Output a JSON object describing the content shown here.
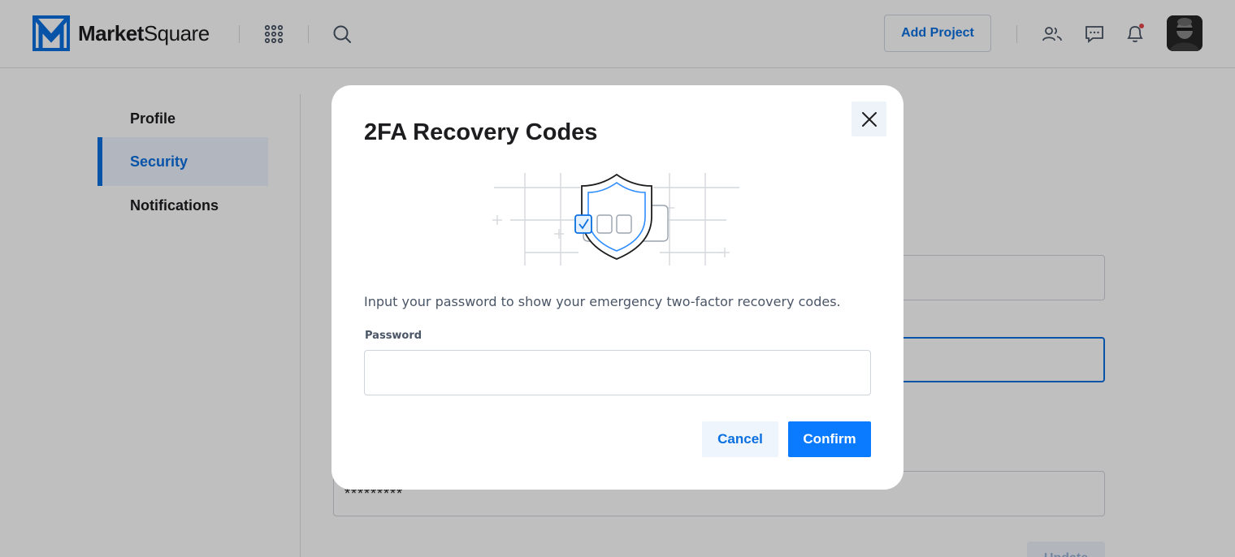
{
  "app": {
    "brand_bold": "Market",
    "brand_light": "Square",
    "add_project_label": "Add Project",
    "brand_color": "#0a6fe0"
  },
  "header_icons": [
    "apps-grid-icon",
    "search-icon",
    "team-icon",
    "chat-icon",
    "bell-icon"
  ],
  "notification_dot_color": "#e5484d",
  "sidebar": {
    "items": [
      {
        "label": "Profile",
        "active": false
      },
      {
        "label": "Security",
        "active": true
      },
      {
        "label": "Notifications",
        "active": false
      }
    ]
  },
  "background_form": {
    "password_value": "*********",
    "update_label": "Update"
  },
  "modal": {
    "title": "2FA Recovery Codes",
    "description": "Input your password to show your emergency two-factor recovery codes.",
    "password_label": "Password",
    "password_value": "",
    "cancel_label": "Cancel",
    "confirm_label": "Confirm"
  }
}
